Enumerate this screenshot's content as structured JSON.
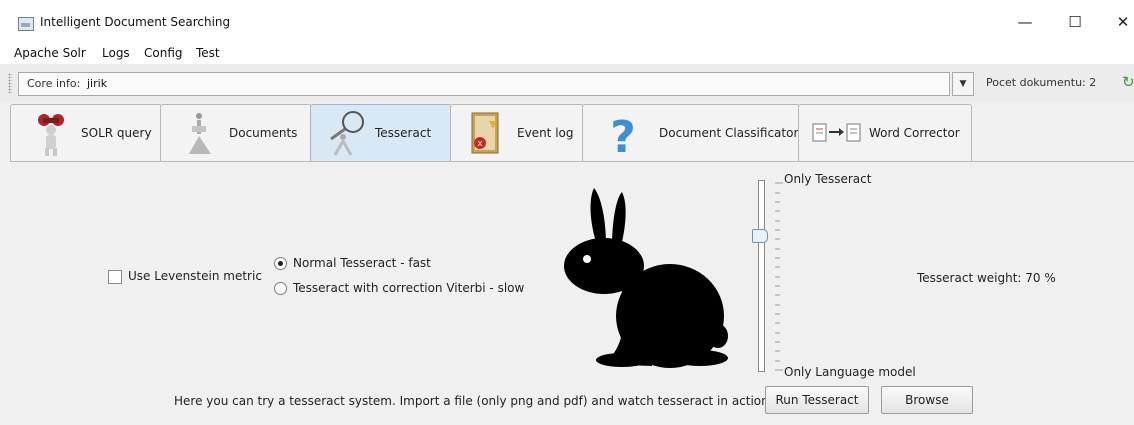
{
  "window": {
    "title": "Intelligent Document Searching",
    "minimize_glyph": "—",
    "maximize_glyph": "☐",
    "close_glyph": "✕"
  },
  "menu": {
    "items": [
      {
        "label": "Apache Solr"
      },
      {
        "label": "Logs"
      },
      {
        "label": "Config"
      },
      {
        "label": "Test"
      }
    ]
  },
  "core": {
    "label": "Core info:",
    "value": "jirik",
    "dropdown_glyph": "▼",
    "doc_count": "Pocet dokumentu: 2",
    "refresh_glyph": "↻"
  },
  "tabs": [
    {
      "label": "SOLR query",
      "icon": "binoculars-icon"
    },
    {
      "label": "Documents",
      "icon": "documents-icon"
    },
    {
      "label": "Tesseract",
      "icon": "magnifier-icon",
      "active": true
    },
    {
      "label": "Event log",
      "icon": "event-log-icon"
    },
    {
      "label": "Document Classificator",
      "icon": "question-icon"
    },
    {
      "label": "Word Corrector",
      "icon": "word-corrector-icon"
    }
  ],
  "tesseract": {
    "levenstein_label": "Use Levenstein metric",
    "levenstein_checked": false,
    "radio_options": [
      {
        "label": "Normal Tesseract - fast",
        "selected": true
      },
      {
        "label": "Tesseract with correction Viterbi - slow",
        "selected": false
      }
    ],
    "slider_top_label": "Only Tesseract",
    "slider_bottom_label": "Only Language model",
    "weight_text": "Tesseract weight: 70 %",
    "weight_value": 70,
    "info_text": "Here you can try a tesseract system. Import a file (only png and pdf) and watch tesseract in action.",
    "run_button": "Run Tesseract",
    "browse_button": "Browse"
  },
  "colors": {
    "active_tab": "#d9e8f5",
    "refresh": "#2ea12e",
    "question": "#3a8fd6"
  }
}
